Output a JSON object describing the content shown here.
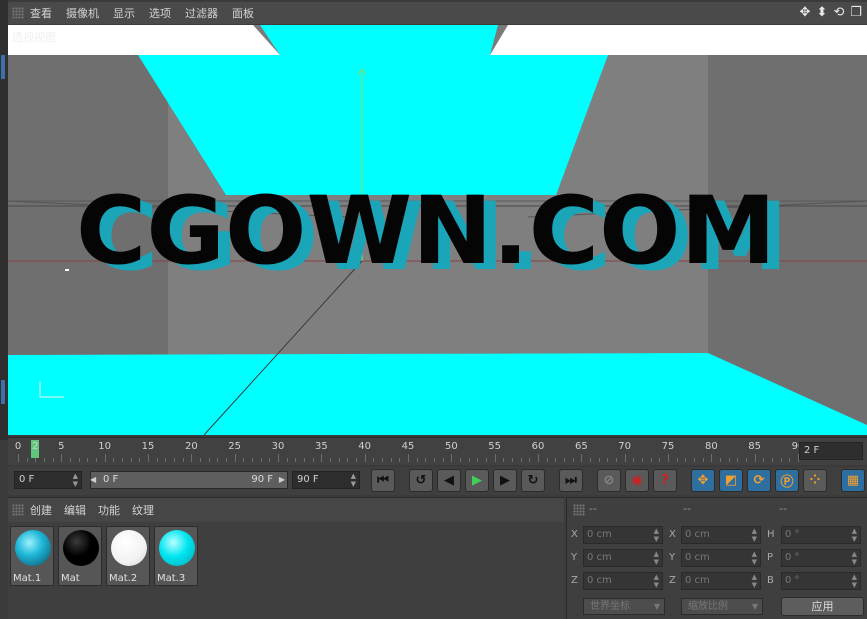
{
  "viewport_menu": {
    "items": [
      "查看",
      "摄像机",
      "显示",
      "选项",
      "过滤器",
      "面板"
    ]
  },
  "viewport": {
    "label": "透视视图",
    "scene_text": "CGOWN.COM",
    "colors": {
      "cyan": "#00ffff",
      "gray": "#7d7d7d",
      "white": "#ffffff"
    }
  },
  "timeline": {
    "labels": [
      "0",
      "2",
      "5",
      "10",
      "15",
      "20",
      "25",
      "30",
      "35",
      "40",
      "45",
      "50",
      "55",
      "60",
      "65",
      "70",
      "75",
      "80",
      "85",
      "90"
    ],
    "current_frame_value": 2,
    "current_frame_field": "2 F"
  },
  "transport": {
    "start_frame": "0 F",
    "range_start": "0 F",
    "range_end": "90 F",
    "end_frame": "90 F"
  },
  "materials_menu": {
    "items": [
      "创建",
      "编辑",
      "功能",
      "纹理"
    ]
  },
  "materials": [
    {
      "name": "Mat.1",
      "color": "#1fb8d8"
    },
    {
      "name": "Mat",
      "color": "#000000"
    },
    {
      "name": "Mat.2",
      "color": "#ffffff"
    },
    {
      "name": "Mat.3",
      "color": "#00e5f0"
    }
  ],
  "coordinates": {
    "headers": [
      "--",
      "--",
      "--"
    ],
    "rows": [
      {
        "pos_label": "X",
        "pos_value": "0 cm",
        "size_label": "X",
        "size_value": "0 cm",
        "rot_label": "H",
        "rot_value": "0 °"
      },
      {
        "pos_label": "Y",
        "pos_value": "0 cm",
        "size_label": "Y",
        "size_value": "0 cm",
        "rot_label": "P",
        "rot_value": "0 °"
      },
      {
        "pos_label": "Z",
        "pos_value": "0 cm",
        "size_label": "Z",
        "size_value": "0 cm",
        "rot_label": "B",
        "rot_value": "0 °"
      }
    ],
    "world_coords": "世界坐标",
    "scale_ratio": "缩放比例",
    "apply_label": "应用"
  }
}
